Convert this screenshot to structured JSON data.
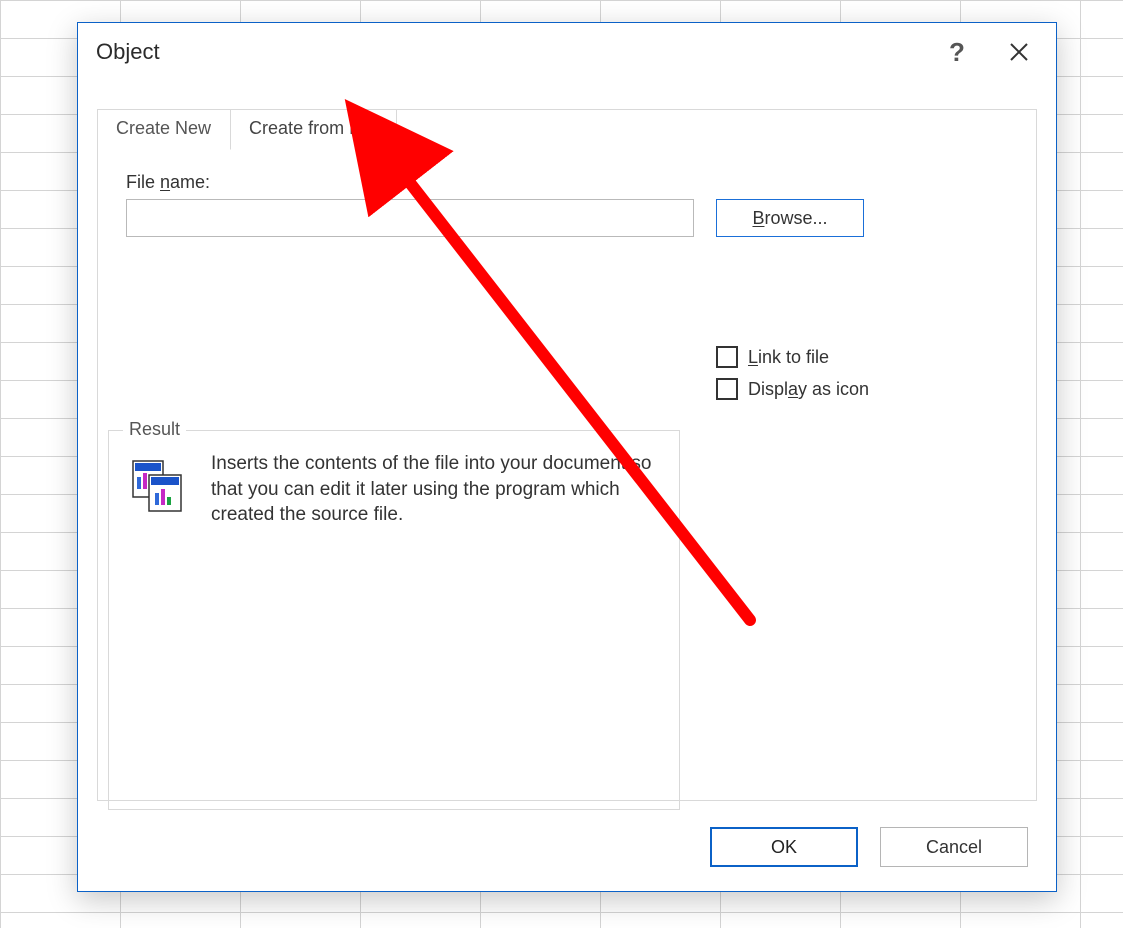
{
  "dialog": {
    "title": "Object",
    "tabs": [
      {
        "label": "Create New",
        "active": false
      },
      {
        "label": "Create from File",
        "active": true
      }
    ],
    "filename": {
      "label_pre": "File ",
      "label_u": "n",
      "label_post": "ame:",
      "value": ""
    },
    "browse": {
      "pre": "",
      "u": "B",
      "post": "rowse..."
    },
    "checkboxes": {
      "link_to_file": {
        "pre": "",
        "u": "L",
        "post": "ink to file",
        "checked": false
      },
      "display_as_icon": {
        "pre": "Displ",
        "u": "a",
        "post": "y as icon",
        "checked": false
      }
    },
    "result": {
      "legend": "Result",
      "text": "Inserts the contents of the file into your document so that you can edit it later using the program which created the source file."
    },
    "buttons": {
      "ok": "OK",
      "cancel": "Cancel"
    }
  }
}
